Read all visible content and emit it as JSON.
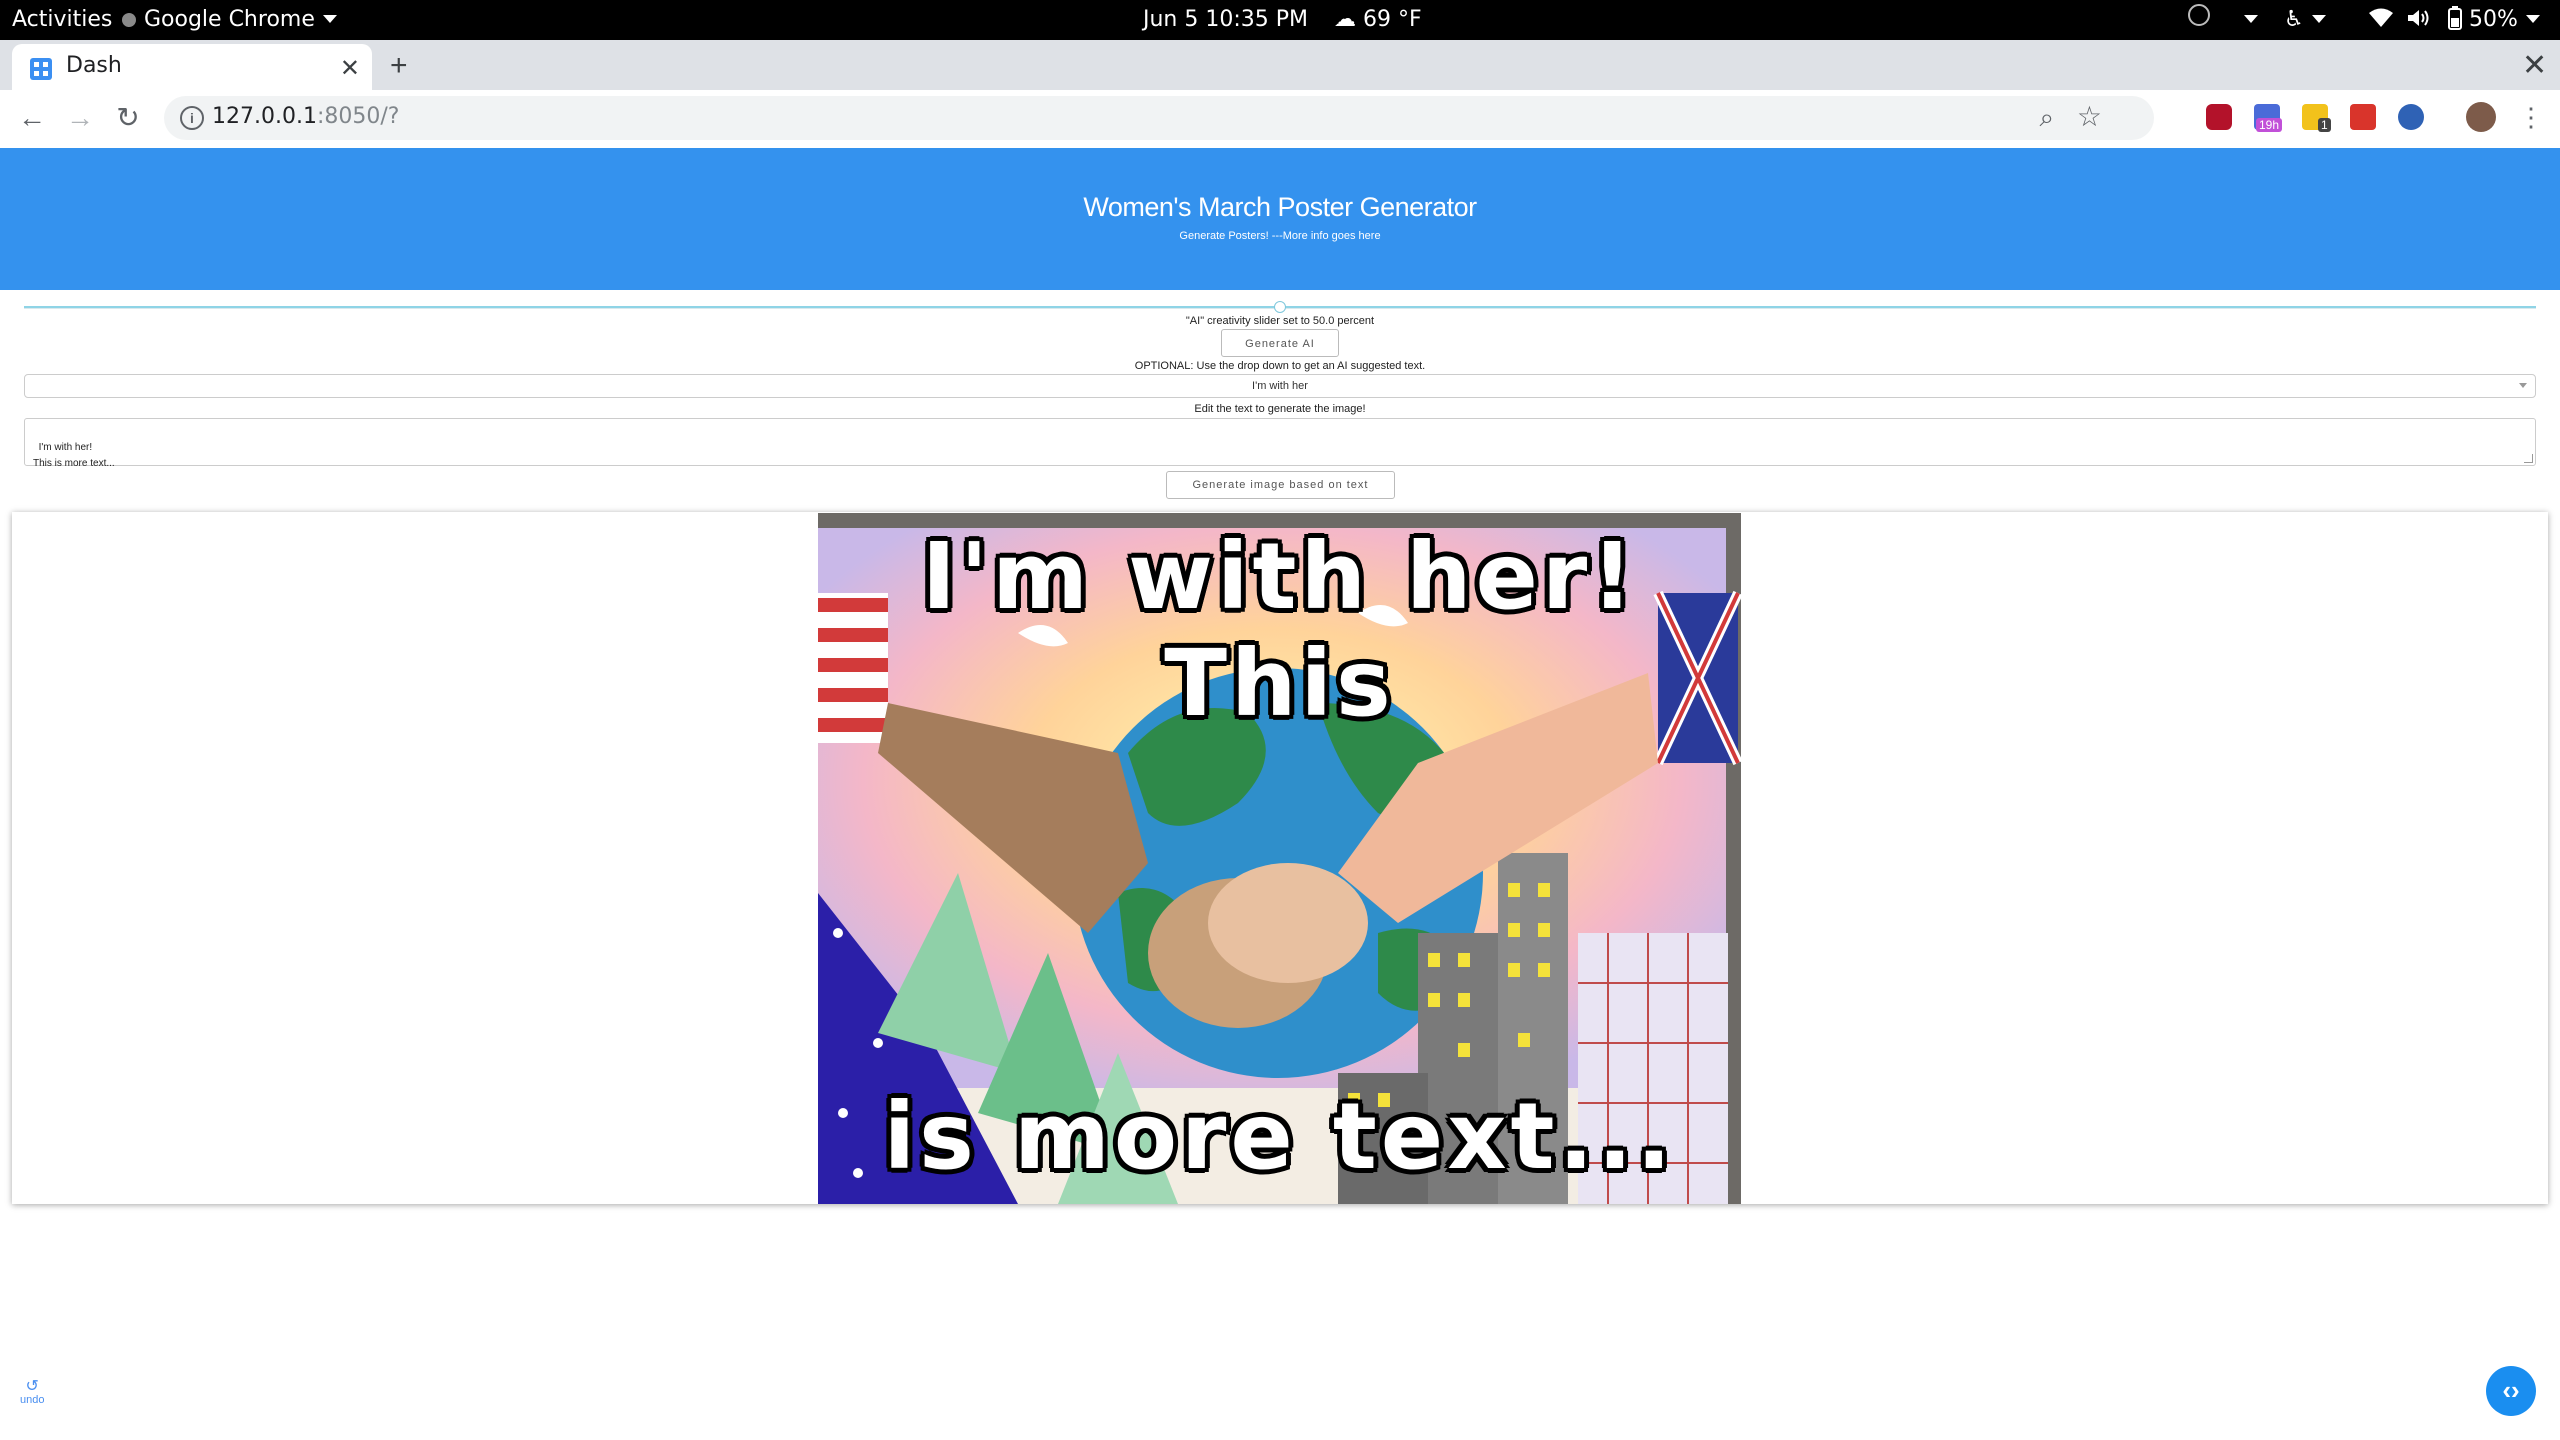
{
  "os_bar": {
    "activities": "Activities",
    "app_name": "Google Chrome",
    "clock": "Jun 5  10:35 PM",
    "weather": "69 °F",
    "battery": "50%"
  },
  "browser": {
    "tab_title": "Dash",
    "url_host": "127.0.0.1",
    "url_rest": ":8050/?",
    "ext_badge_time": "19h",
    "ext_badge_count": "1"
  },
  "page": {
    "header_title": "Women's March Poster Generator",
    "header_subtitle": "Generate Posters! ---More info goes here",
    "slider_value": 50.0,
    "slider_text": "\"AI\" creativity slider set to 50.0 percent",
    "generate_ai_label": "Generate AI",
    "optional_text": "OPTIONAL: Use the drop down to get an AI suggested text.",
    "dropdown_value": "I'm with her",
    "edit_text_label": "Edit the text to generate the image!",
    "textarea_value": "I'm with her!\nThis is more text...",
    "generate_image_label": "Generate image based on text",
    "poster_top_text": "I'm with her! This",
    "poster_bottom_text": "is more text...",
    "undo_label": "undo"
  },
  "colors": {
    "header_bg": "#3492ee",
    "slider_track": "#8fd4e6",
    "devtools_button": "#1a8ef0"
  },
  "icons": {
    "back": "arrow-left-icon",
    "forward": "arrow-right-icon",
    "reload": "reload-icon",
    "zoom": "zoom-icon",
    "bookmark": "star-icon",
    "menu": "more-vert-icon",
    "devtools": "code-brackets-icon"
  }
}
